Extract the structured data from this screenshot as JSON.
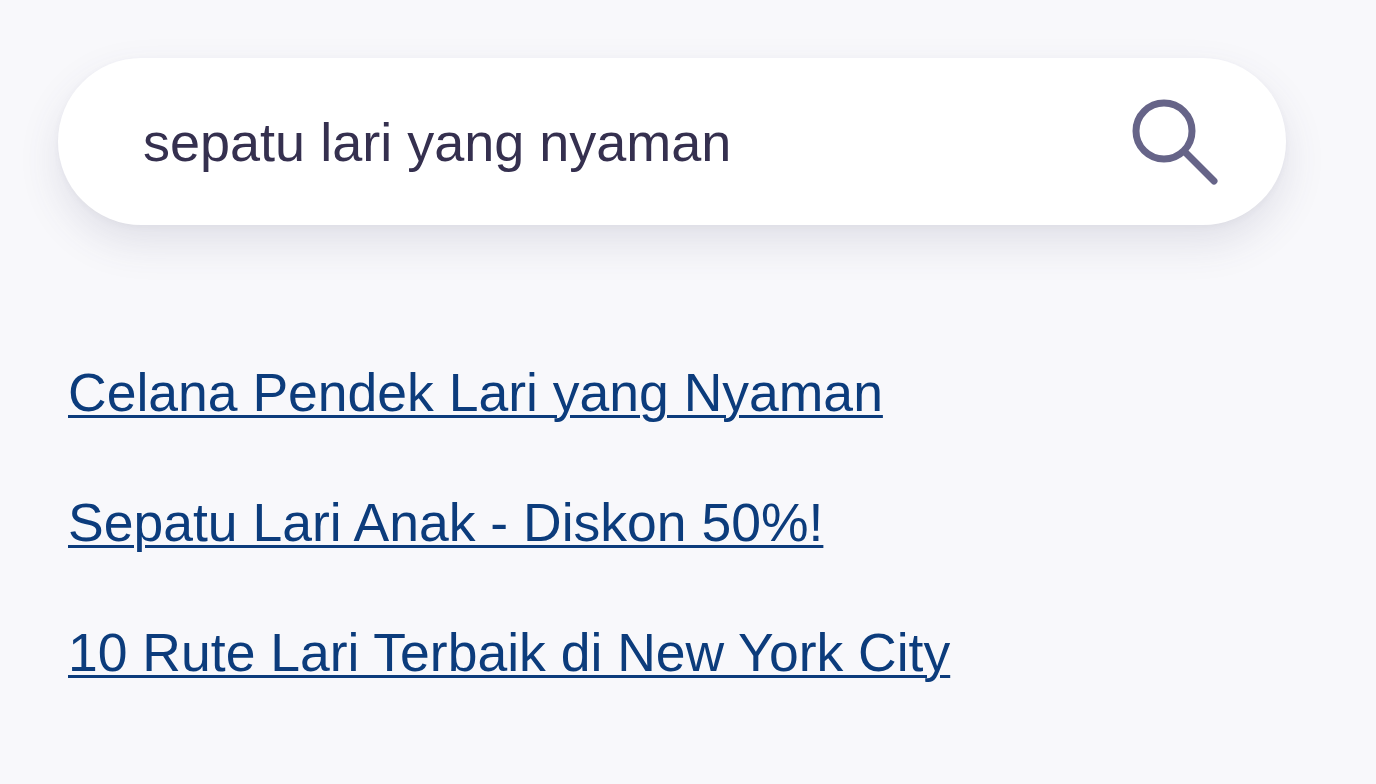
{
  "search": {
    "value": "sepatu lari yang nyaman"
  },
  "links": [
    {
      "label": "Celana Pendek Lari yang Nyaman"
    },
    {
      "label": "Sepatu Lari Anak - Diskon 50%!"
    },
    {
      "label": "10 Rute Lari Terbaik di New York City"
    }
  ]
}
